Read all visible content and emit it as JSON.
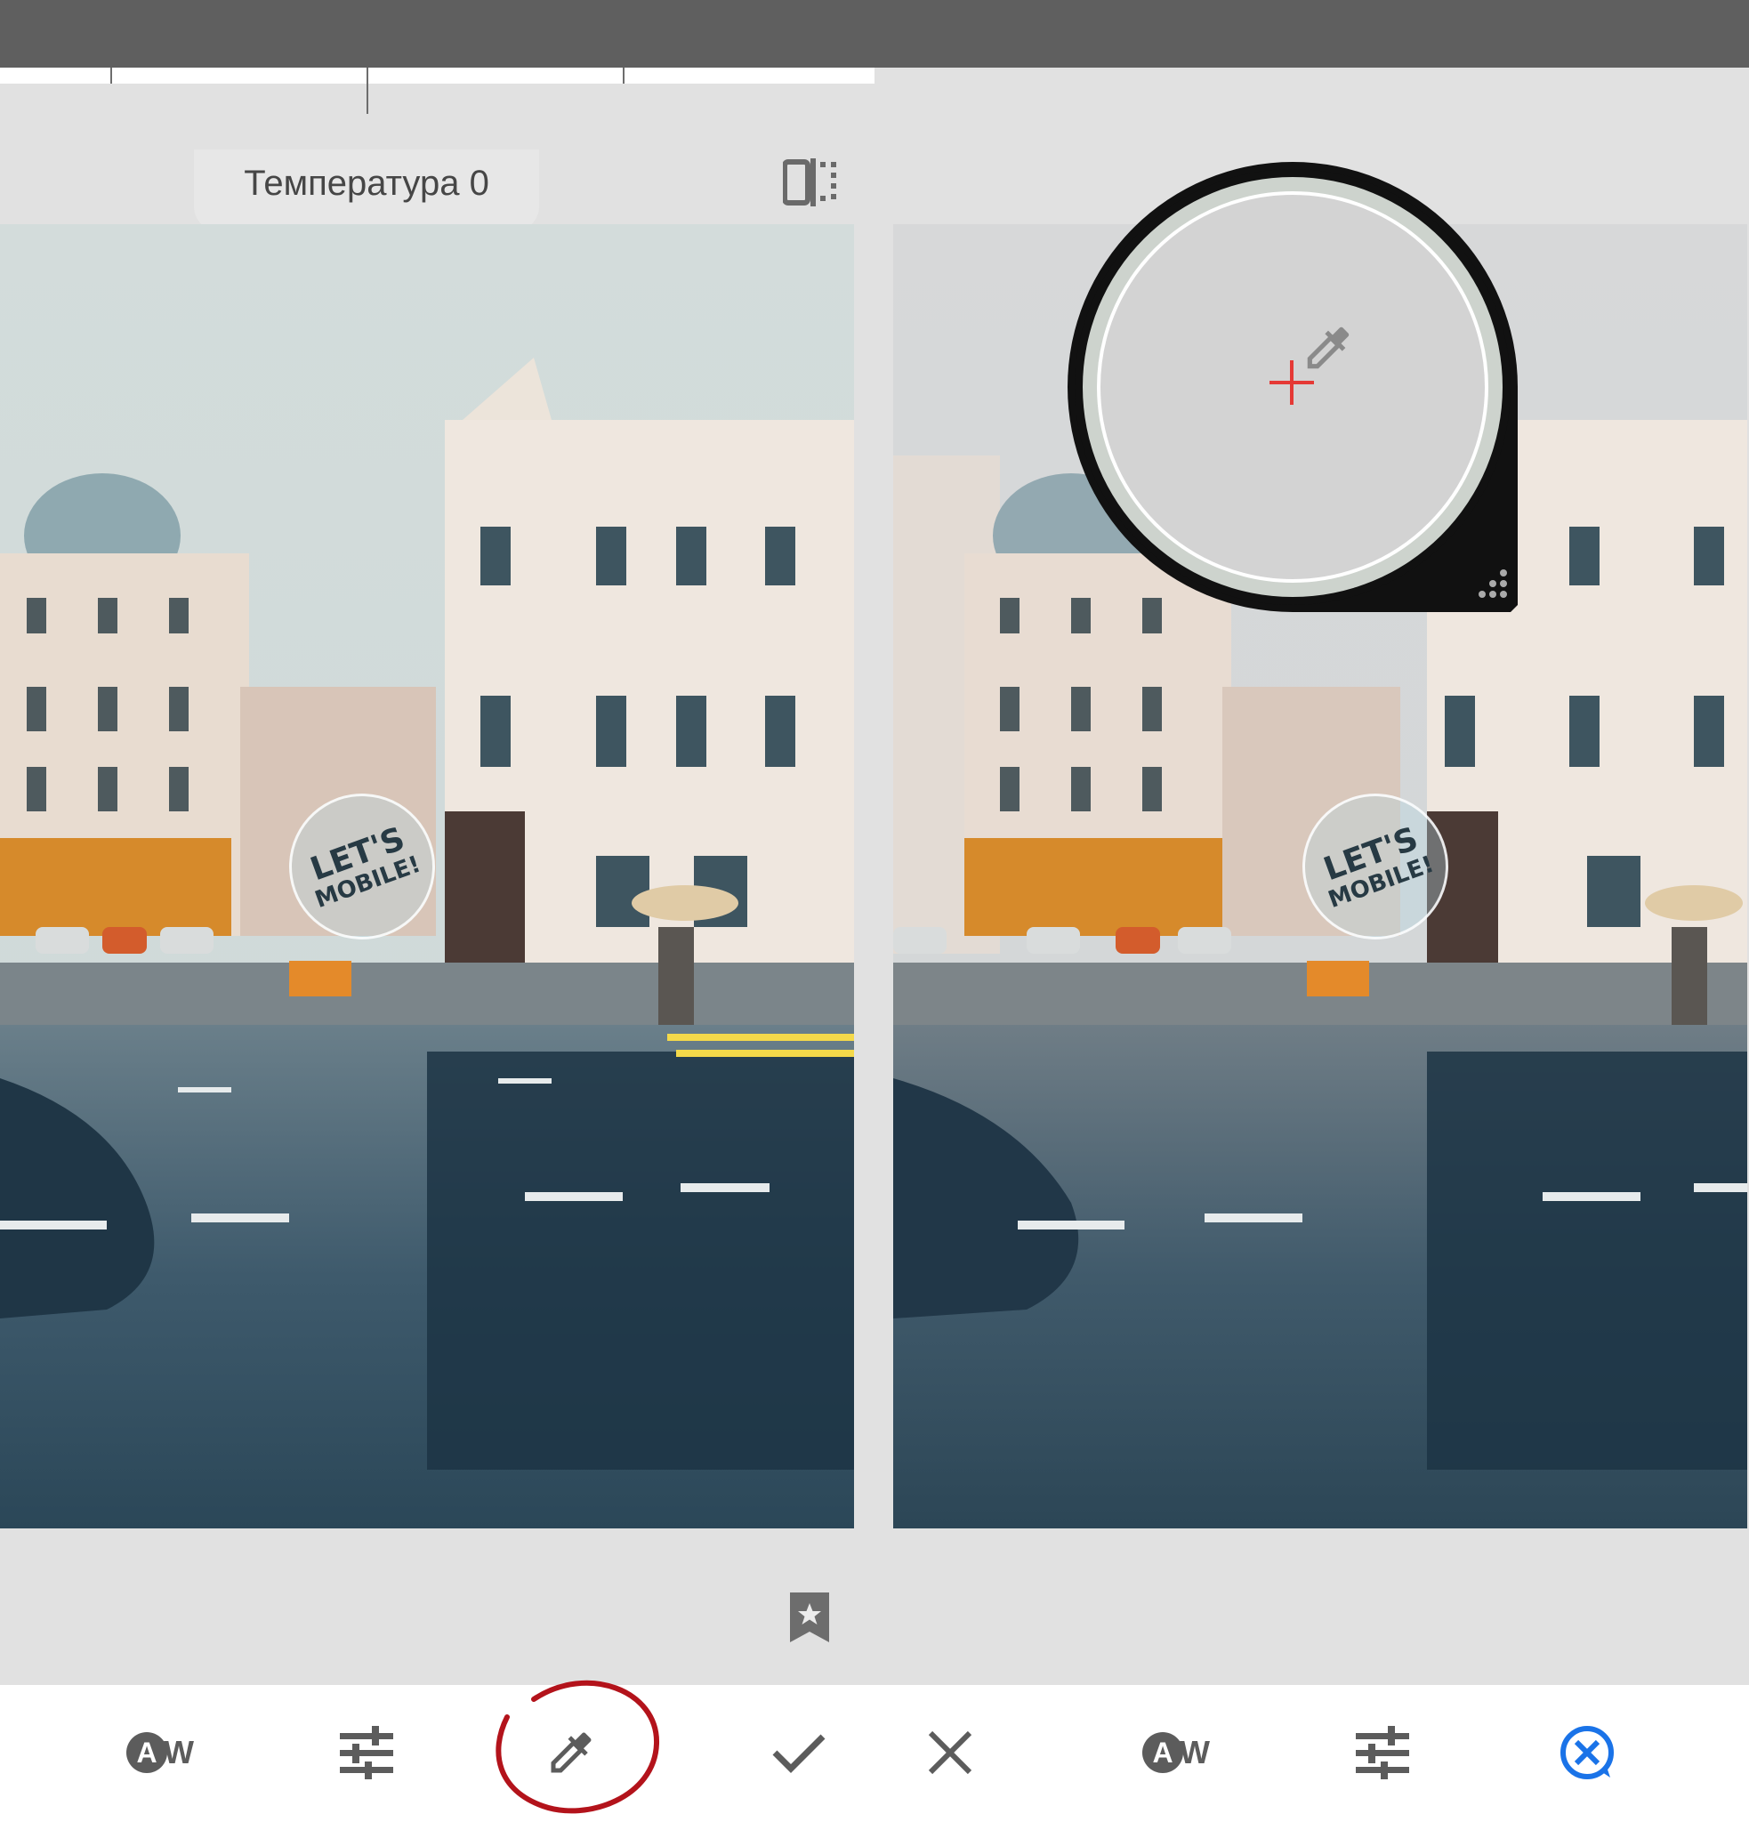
{
  "left_screen": {
    "adjustment_label": "Температура 0",
    "badge": {
      "line1": "LET'S",
      "line2": "MOBILE!"
    }
  },
  "right_screen": {
    "badge": {
      "line1": "LET'S",
      "line2": "MOBILE!"
    }
  },
  "toolbar_left": {
    "items": [
      {
        "icon": "auto-white-balance-icon",
        "label_a": "A",
        "label_w": "W"
      },
      {
        "icon": "adjust-sliders-icon"
      },
      {
        "icon": "eyedropper-icon",
        "annotated": true
      },
      {
        "icon": "checkmark-icon"
      }
    ]
  },
  "toolbar_right": {
    "items": [
      {
        "icon": "close-icon"
      },
      {
        "icon": "auto-white-balance-icon",
        "label_a": "A",
        "label_w": "W"
      },
      {
        "icon": "adjust-sliders-icon"
      },
      {
        "icon": "cancel-eyedropper-icon"
      }
    ]
  },
  "colors": {
    "top_bar": "#5f5f5f",
    "panel_bg": "#e1e1e1",
    "icon_gray": "#5c5c5c",
    "accent_blue": "#1a73e8",
    "annotation_red": "#b3131b",
    "crosshair_red": "#e53935"
  }
}
